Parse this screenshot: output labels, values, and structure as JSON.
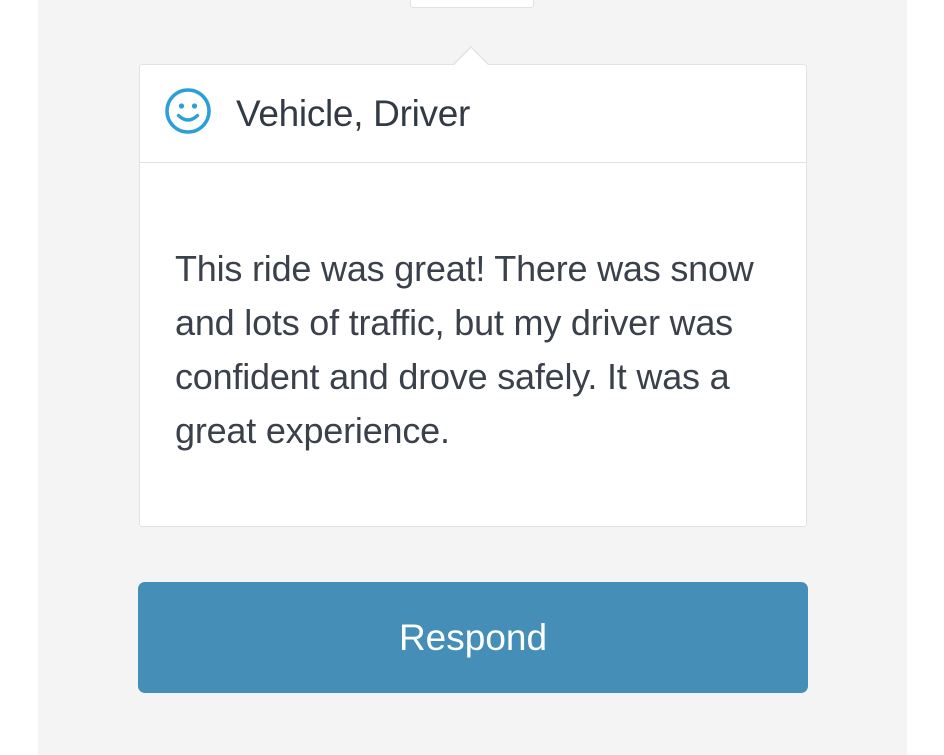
{
  "review": {
    "category_icon": "smiley-icon",
    "categories": "Vehicle, Driver",
    "comment": "This ride was great! There was snow and lots of traffic, but my driver was confident and drove safely. It was a great experience."
  },
  "actions": {
    "respond_label": "Respond"
  },
  "colors": {
    "accent": "#448eb8",
    "icon": "#2c9fd9",
    "background": "#f4f4f4",
    "text": "#3a414a"
  }
}
